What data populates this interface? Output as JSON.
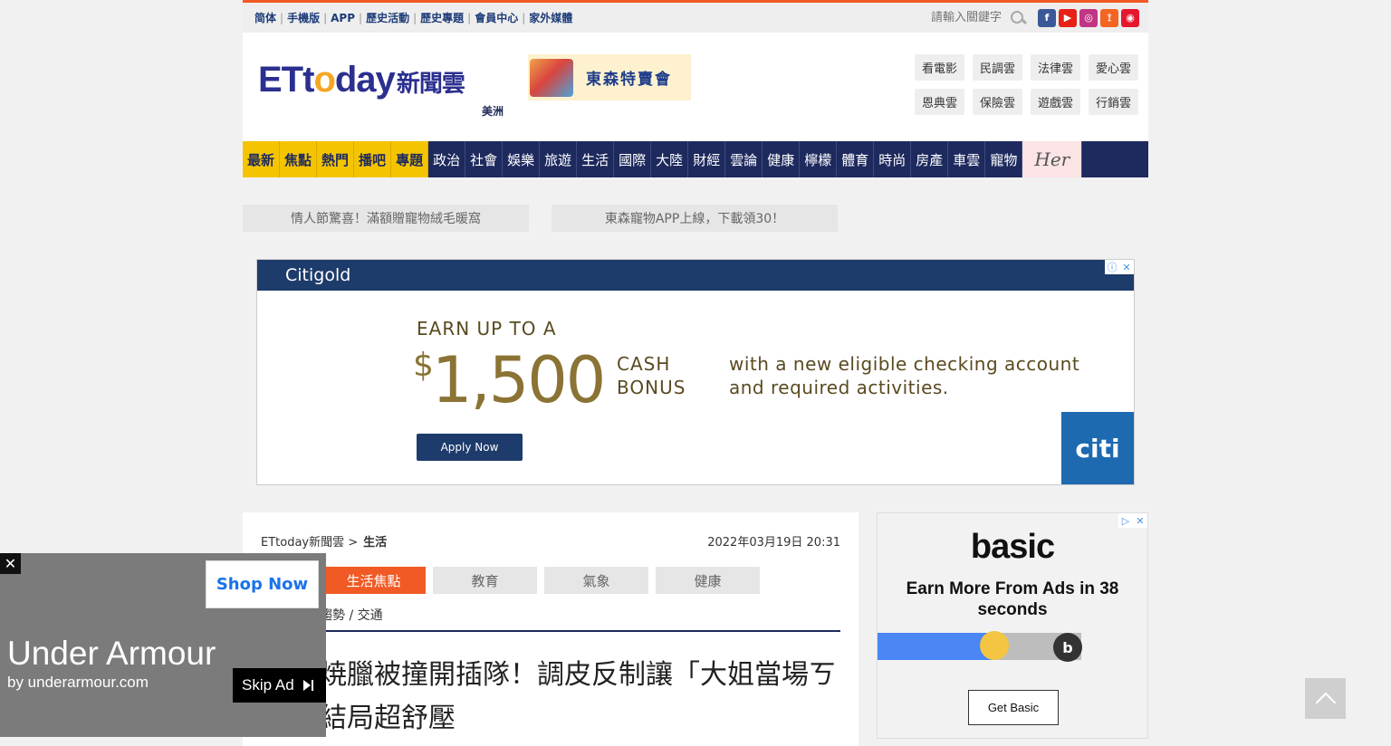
{
  "topbar": {
    "links": [
      "简体",
      "手機版",
      "APP",
      "歷史活動",
      "歷史專題",
      "會員中心",
      "家外媒體"
    ],
    "search_placeholder": "請輸入關鍵字",
    "social": [
      {
        "icon": "facebook-icon",
        "glyph": "f",
        "color": "#3b5998"
      },
      {
        "icon": "youtube-icon",
        "glyph": "▶",
        "color": "#e62117"
      },
      {
        "icon": "instagram-icon",
        "glyph": "◎",
        "color": "#c13584"
      },
      {
        "icon": "rss-icon",
        "glyph": "⟟",
        "color": "#f26522"
      },
      {
        "icon": "weibo-icon",
        "glyph": "◉",
        "color": "#e6162d"
      }
    ]
  },
  "header": {
    "logo_text_a": "ETt",
    "logo_text_o": "o",
    "logo_text_b": "day",
    "logo_cloud": "新聞雲",
    "logo_sub": "美洲",
    "promo_text": "東森特賣會",
    "cloud_links": [
      "看電影",
      "民調雲",
      "法律雲",
      "愛心雲",
      "恩典雲",
      "保險雲",
      "遊戲雲",
      "行銷雲"
    ]
  },
  "nav": {
    "highlighted": [
      "最新",
      "焦點",
      "熱門",
      "播吧",
      "專題"
    ],
    "items": [
      "政治",
      "社會",
      "娛樂",
      "旅遊",
      "生活",
      "國際",
      "大陸",
      "財經",
      "雲論",
      "健康",
      "檸檬",
      "體育",
      "時尚",
      "房產",
      "車雲",
      "寵物"
    ],
    "her": "Her"
  },
  "promo_links": [
    "情人節驚喜！滿額贈寵物絨毛暖窩",
    "東森寵物APP上線，下載領30！"
  ],
  "citi_ad": {
    "brand_top": "Citigold",
    "earn": "EARN UP TO A",
    "dollar": "$",
    "amount": "1,500",
    "bonus_line1": "CASH",
    "bonus_line2": "BONUS",
    "desc": "with a new eligible checking account and required activities.",
    "apply_label": "Apply Now",
    "logo": "citi",
    "badge_info": "ⓘ",
    "badge_close": "✕"
  },
  "article": {
    "breadcrumb_home": "ETtoday新聞雲 >",
    "breadcrumb_section": "生活",
    "date": "2022年03月19日 20:31",
    "tabs": [
      "生活焦點",
      "教育",
      "氣象",
      "健康"
    ],
    "subtopics": "趨勢 / 交通",
    "headline": "焼臘被撞開插隊！調皮反制讓「大姐當場ㄎ　　結局超舒壓"
  },
  "basic_ad": {
    "logo": "basic",
    "tagline": "Earn More From Ads in 38 seconds",
    "progress": 0.56,
    "b_glyph": "b",
    "button": "Get Basic",
    "badge_play": "▷",
    "badge_close": "✕"
  },
  "ua_ad": {
    "close": "✕",
    "shop_now": "Shop Now",
    "title": "Under Armour",
    "by": "by underarmour.com",
    "skip": "Skip Ad"
  }
}
